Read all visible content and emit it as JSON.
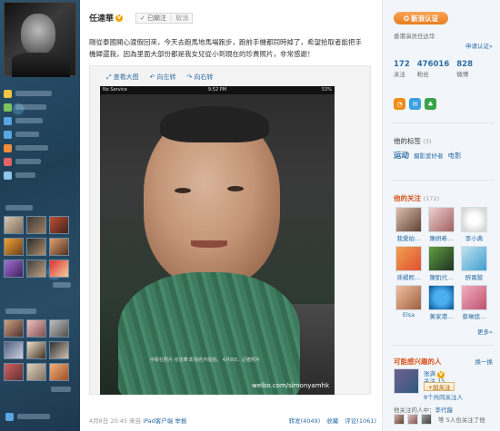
{
  "profile": {
    "name": "任達華",
    "verified_mark": "V",
    "followed_label": "已關注",
    "cancel_label": "取消"
  },
  "post": {
    "text": "剛從泰國開心渡假回來，今天去跑馬地馬場跑步，跑前手機都同時掉了，希望拾取者能把手機歸還我，因為里面大部份都是我女兒從小到現在的珍貴照片，非常感謝！",
    "tools": [
      "查看大图",
      "向左转",
      "向右转"
    ],
    "photo_status_left": "No Service",
    "photo_status_time": "9:52 PM",
    "photo_status_battery": "53%",
    "photo_subtitle": "中新社照片 任達華 影視名不能拍。 4月8日，記者照片",
    "watermark": "weibo.com/simonyamhk",
    "date": "4月8日 20:45 来自",
    "source": "iPad客户端",
    "report": "举报",
    "actions": [
      "转发(4049)",
      "收藏",
      "评论(1061)"
    ]
  },
  "verify": {
    "button": "新浪认证",
    "desc": "香港演员任达华",
    "apply": "申请认证»"
  },
  "stats": [
    {
      "num": "172",
      "label": "关注"
    },
    {
      "num": "476016",
      "label": "粉丝"
    },
    {
      "num": "828",
      "label": "微博"
    }
  ],
  "tags": {
    "title": "他的标签",
    "count": "(3)",
    "items": [
      "运动",
      "摄影爱好者",
      "电影"
    ]
  },
  "follows": {
    "title": "他的关注",
    "count": "(172)",
    "items": [
      "我愛拍…",
      "陳妍希…",
      "李小典",
      "孫楊熙…",
      "陳凱代…",
      "醉兩陂",
      "Elsa",
      "黃家港…",
      "蔡琳悠…"
    ],
    "more": "更多»"
  },
  "suggest": {
    "title": "可能感兴趣的人",
    "swap": "换一换",
    "name": "张满",
    "meta": "关注 15",
    "add": "+加关注",
    "extra": "8个共同关注人",
    "mutual_prefix": "他关注的人中：",
    "mutual_names": "李代龍",
    "mutual_text": "等 5人也关注了他"
  },
  "colors": {
    "link": "#2a6da6",
    "accent_orange": "#e97c1f",
    "sidebar_bg": "#24465f"
  }
}
